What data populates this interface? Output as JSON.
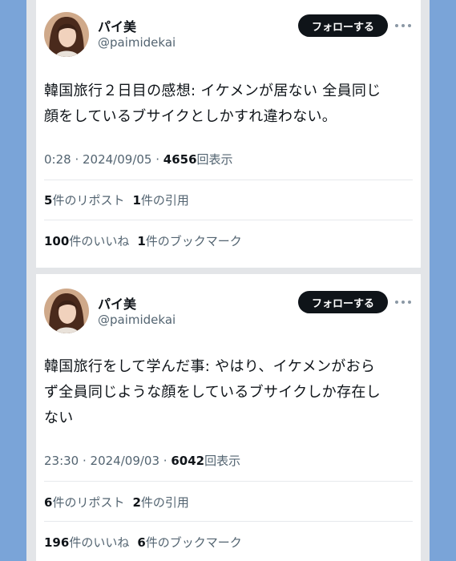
{
  "tweets": [
    {
      "user": {
        "name": "パイ美",
        "handle": "@paimidekai"
      },
      "follow_label": "フォローする",
      "text_lines": [
        "韓国旅行２日目の感想: イケメンが居ない 全員同じ",
        "顔をしているブサイクとしかすれ違わない。"
      ],
      "time": "0:28",
      "date": "2024/09/05",
      "views_count": "4656",
      "views_label": "回表示",
      "reposts_count": "5",
      "reposts_label": "件のリポスト",
      "quotes_count": "1",
      "quotes_label": "件の引用",
      "likes_count": "100",
      "likes_label": "件のいいね",
      "bookmarks_count": "1",
      "bookmarks_label": "件のブックマーク"
    },
    {
      "user": {
        "name": "パイ美",
        "handle": "@paimidekai"
      },
      "follow_label": "フォローする",
      "text_lines": [
        "韓国旅行をして学んだ事: やはり、イケメンがおら",
        "ず全員同じような顔をしているブサイクしか存在し",
        "ない"
      ],
      "time": "23:30",
      "date": "2024/09/03",
      "views_count": "6042",
      "views_label": "回表示",
      "reposts_count": "6",
      "reposts_label": "件のリポスト",
      "quotes_count": "2",
      "quotes_label": "件の引用",
      "likes_count": "196",
      "likes_label": "件のいいね",
      "bookmarks_count": "6",
      "bookmarks_label": "件のブックマーク"
    }
  ],
  "separator": " · ",
  "icons": {
    "avatar": "avatar-photo-icon",
    "more": "more-options-icon"
  },
  "colors": {
    "page_bg": "#7aa4d8",
    "follow_button": "#0f1419",
    "secondary_text": "#536471"
  }
}
